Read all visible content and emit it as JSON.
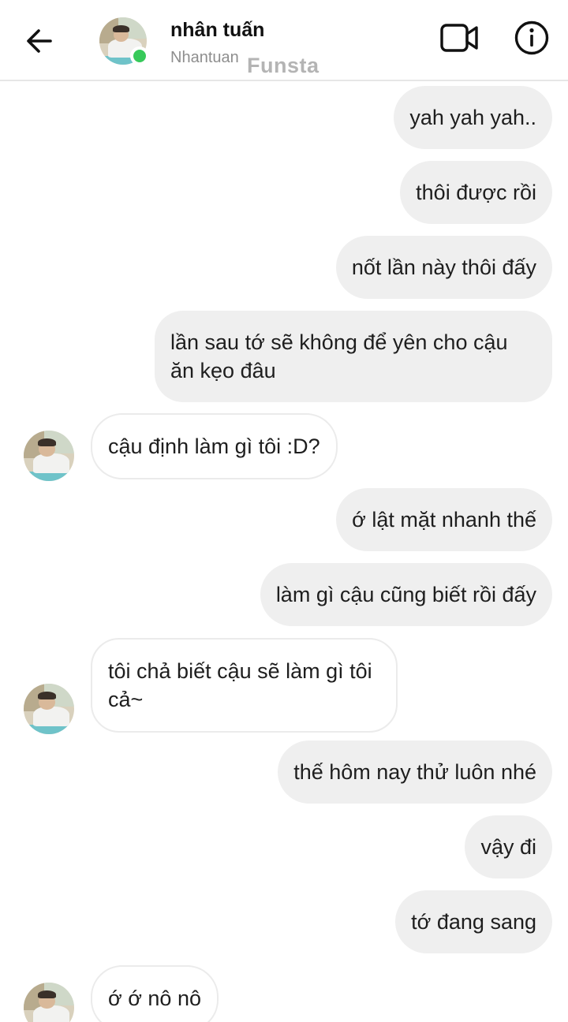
{
  "header": {
    "back_icon": "arrow-left-icon",
    "contact_name": "nhân tuấn",
    "username": "Nhantuan",
    "watermark": "Funsta",
    "online_status_color": "#37c95a",
    "video_icon": "video-camera-icon",
    "info_icon": "info-icon"
  },
  "messages": [
    {
      "side": "sent",
      "text": "yah yah yah.."
    },
    {
      "side": "sent",
      "text": "thôi được rồi"
    },
    {
      "side": "sent",
      "text": "nốt lần này thôi đấy"
    },
    {
      "side": "sent",
      "text": "lần sau tớ sẽ không để yên cho cậu ăn kẹo đâu"
    },
    {
      "side": "received",
      "text": "cậu định làm gì tôi :D?"
    },
    {
      "side": "sent",
      "text": "ớ lật mặt nhanh thế"
    },
    {
      "side": "sent",
      "text": "làm gì cậu cũng biết rồi đấy"
    },
    {
      "side": "received",
      "text": "tôi chả biết cậu sẽ làm gì tôi cả~"
    },
    {
      "side": "sent",
      "text": "thế hôm nay thử luôn nhé"
    },
    {
      "side": "sent",
      "text": "vậy đi"
    },
    {
      "side": "sent",
      "text": "tớ đang sang"
    },
    {
      "side": "received",
      "text": "ớ ớ nô nô"
    }
  ]
}
